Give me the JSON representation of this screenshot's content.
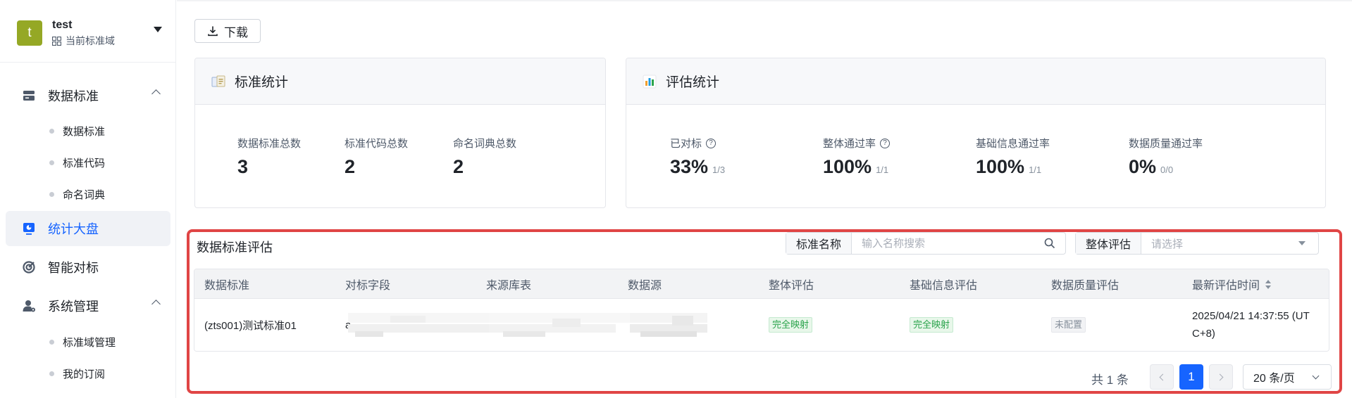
{
  "sidebar": {
    "domain": {
      "avatar_letter": "t",
      "name": "test",
      "subtitle": "当前标准域",
      "avatar_color": "#95a825"
    },
    "menu": {
      "data_standard": {
        "label": "数据标准",
        "children": [
          "数据标准",
          "标准代码",
          "命名词典"
        ]
      },
      "dashboard": {
        "label": "统计大盘"
      },
      "smart_mapping": {
        "label": "智能对标"
      },
      "system": {
        "label": "系统管理",
        "children": [
          "标准域管理",
          "我的订阅"
        ]
      }
    }
  },
  "toolbar": {
    "download_label": "下载"
  },
  "standard_stats": {
    "title": "标准统计",
    "items": [
      {
        "label": "数据标准总数",
        "value": "3"
      },
      {
        "label": "标准代码总数",
        "value": "2"
      },
      {
        "label": "命名词典总数",
        "value": "2"
      }
    ]
  },
  "eval_stats": {
    "title": "评估统计",
    "items": [
      {
        "label": "已对标",
        "value": "33%",
        "fraction": "1/3",
        "help": true
      },
      {
        "label": "整体通过率",
        "value": "100%",
        "fraction": "1/1",
        "help": true
      },
      {
        "label": "基础信息通过率",
        "value": "100%",
        "fraction": "1/1",
        "help": false
      },
      {
        "label": "数据质量通过率",
        "value": "0%",
        "fraction": "0/0",
        "help": false
      }
    ]
  },
  "evaluation": {
    "title": "数据标准评估",
    "filters": {
      "name": {
        "label": "标准名称",
        "placeholder": "输入名称搜索"
      },
      "overall": {
        "label": "整体评估",
        "placeholder": "请选择"
      }
    },
    "columns": [
      "数据标准",
      "对标字段",
      "来源库表",
      "数据源",
      "整体评估",
      "基础信息评估",
      "数据质量评估",
      "最新评估时间"
    ],
    "rows": [
      {
        "standard": "(zts001)测试标准01",
        "field_prefix": "a",
        "overall": "完全映射",
        "basic": "完全映射",
        "quality": "未配置",
        "time": "2025/04/21 14:37:55 (UTC+8)"
      }
    ],
    "pagination": {
      "total": "共 1 条",
      "current_page": "1",
      "page_size": "20 条/页"
    }
  },
  "colors": {
    "accent": "#1664ff",
    "highlight_border": "#e04545",
    "success": "#2ba44c"
  }
}
